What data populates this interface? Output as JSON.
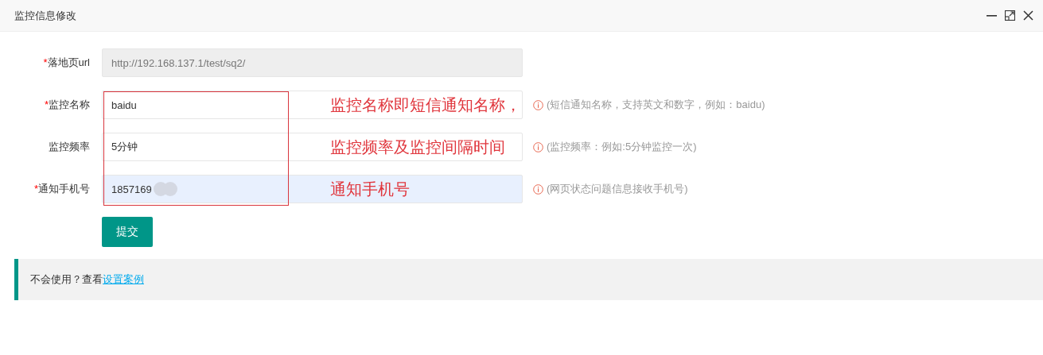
{
  "window": {
    "title": "监控信息修改"
  },
  "fields": [
    {
      "label": "落地页url",
      "required_mark": "*",
      "value": "http://192.168.137.1/test/sq2/",
      "disabled": true,
      "highlighted": false
    },
    {
      "label": "监控名称",
      "required_mark": "*",
      "value": "baidu",
      "disabled": false,
      "highlighted": false,
      "annotation": "监控名称即短信通知名称，",
      "hint": "(短信通知名称，支持英文和数字，例如：baidu)"
    },
    {
      "label": "监控频率",
      "value": "5分钟",
      "disabled": false,
      "highlighted": false,
      "annotation": "监控频率及监控间隔时间",
      "hint": "(监控频率：例如:5分钟监控一次)"
    },
    {
      "label": "通知手机号",
      "required_mark": "*",
      "value": "1857169",
      "redacted": true,
      "disabled": false,
      "highlighted": true,
      "annotation": "通知手机号",
      "hint": "(网页状态问题信息接收手机号)"
    }
  ],
  "submit_button": "提交",
  "tip": {
    "text": "不会使用？查看",
    "link": "设置案例"
  }
}
